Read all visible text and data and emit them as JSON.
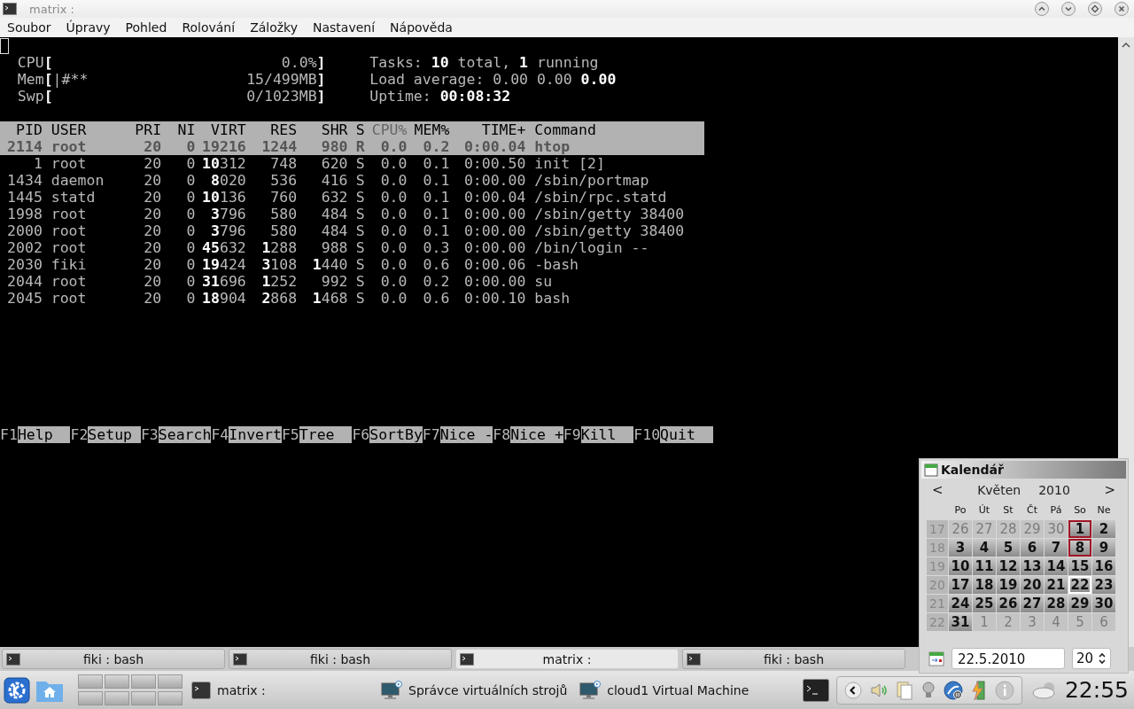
{
  "window": {
    "title": "matrix :"
  },
  "menu": [
    "Soubor",
    "Úpravy",
    "Pohled",
    "Rolování",
    "Záložky",
    "Nastavení",
    "Nápověda"
  ],
  "meters": [
    {
      "label": "CPU**[**",
      "value": "0.0%**]**"
    },
    {
      "label": "Mem**[**",
      "bar": "|#**",
      "value": "15/499MB**]**"
    },
    {
      "label": "Swp**[**",
      "value": "0/1023MB**]**"
    }
  ],
  "summary": [
    {
      "label": "Tasks:",
      "value": "**10** total, **1** running"
    },
    {
      "label": "Load average:",
      "value": "0.00 0.00 **0.00**"
    },
    {
      "label": "Uptime:",
      "value": "**00:08:32**"
    }
  ],
  "columns": [
    {
      "label": "PID",
      "sorted": false
    },
    {
      "label": "USER",
      "sorted": false
    },
    {
      "label": "PRI",
      "sorted": false
    },
    {
      "label": "NI",
      "sorted": false
    },
    {
      "label": "VIRT",
      "sorted": false
    },
    {
      "label": "RES",
      "sorted": false
    },
    {
      "label": "SHR",
      "sorted": false
    },
    {
      "label": "S",
      "sorted": false
    },
    {
      "label": "CPU%",
      "sorted": true
    },
    {
      "label": "MEM%",
      "sorted": false
    },
    {
      "label": "TIME+",
      "sorted": false
    },
    {
      "label": "Command",
      "sorted": false
    }
  ],
  "processes": [
    {
      "selected": true,
      "cells": [
        "2114",
        "root",
        "20",
        "0",
        "19216",
        "1244",
        "980",
        "R",
        "0.0",
        "0.2",
        "0:00.04",
        "htop"
      ]
    },
    {
      "selected": false,
      "cells": [
        "1",
        "root",
        "20",
        "0",
        "**10**312",
        "748",
        "620",
        "S",
        "0.0",
        "0.1",
        "0:00.50",
        "init [2]"
      ]
    },
    {
      "selected": false,
      "cells": [
        "1434",
        "daemon",
        "20",
        "0",
        "**8**020",
        "536",
        "416",
        "S",
        "0.0",
        "0.1",
        "0:00.00",
        "/sbin/portmap"
      ]
    },
    {
      "selected": false,
      "cells": [
        "1445",
        "statd",
        "20",
        "0",
        "**10**136",
        "760",
        "632",
        "S",
        "0.0",
        "0.1",
        "0:00.04",
        "/sbin/rpc.statd"
      ]
    },
    {
      "selected": false,
      "cells": [
        "1998",
        "root",
        "20",
        "0",
        "**3**796",
        "580",
        "484",
        "S",
        "0.0",
        "0.1",
        "0:00.00",
        "/sbin/getty 38400"
      ]
    },
    {
      "selected": false,
      "cells": [
        "2000",
        "root",
        "20",
        "0",
        "**3**796",
        "580",
        "484",
        "S",
        "0.0",
        "0.1",
        "0:00.00",
        "/sbin/getty 38400"
      ]
    },
    {
      "selected": false,
      "cells": [
        "2002",
        "root",
        "20",
        "0",
        "**45**632",
        "**1**288",
        "988",
        "S",
        "0.0",
        "0.3",
        "0:00.00",
        "/bin/login --"
      ]
    },
    {
      "selected": false,
      "cells": [
        "2030",
        "fiki",
        "20",
        "0",
        "**19**424",
        "**3**108",
        "**1**440",
        "S",
        "0.0",
        "0.6",
        "0:00.06",
        "-bash"
      ]
    },
    {
      "selected": false,
      "cells": [
        "2044",
        "root",
        "20",
        "0",
        "**31**696",
        "**1**252",
        "992",
        "S",
        "0.0",
        "0.2",
        "0:00.00",
        "su"
      ]
    },
    {
      "selected": false,
      "cells": [
        "2045",
        "root",
        "20",
        "0",
        "**18**904",
        "**2**868",
        "**1**468",
        "S",
        "0.0",
        "0.6",
        "0:00.10",
        "bash"
      ]
    }
  ],
  "function_keys": [
    {
      "key": "F1",
      "label": "Help"
    },
    {
      "key": "F2",
      "label": "Setup"
    },
    {
      "key": "F3",
      "label": "Search"
    },
    {
      "key": "F4",
      "label": "Invert"
    },
    {
      "key": "F5",
      "label": "Tree"
    },
    {
      "key": "F6",
      "label": "SortBy"
    },
    {
      "key": "F7",
      "label": "Nice -"
    },
    {
      "key": "F8",
      "label": "Nice +"
    },
    {
      "key": "F9",
      "label": "Kill"
    },
    {
      "key": "F10",
      "label": "Quit"
    }
  ],
  "tabs": [
    {
      "label": "fiki : bash",
      "selected": false
    },
    {
      "label": "fiki : bash",
      "selected": false
    },
    {
      "label": "matrix :",
      "selected": true
    },
    {
      "label": "fiki : bash",
      "selected": false
    }
  ],
  "tasks": [
    {
      "label": "matrix :",
      "kind": "terminal"
    },
    {
      "label": "Správce virtuálních strojů",
      "kind": "vm"
    },
    {
      "label": "cloud1 Virtual Machine",
      "kind": "vm"
    }
  ],
  "clock": "22:55",
  "calendar": {
    "title": "Kalendář",
    "prev": "<",
    "month": "Květen",
    "year": "2010",
    "next": ">",
    "weekdays": [
      "Po",
      "Út",
      "St",
      "Čt",
      "Pá",
      "So",
      "Ne"
    ],
    "weeks": [
      {
        "number": "17",
        "days": [
          {
            "label": "26",
            "in_month": false,
            "holiday": false,
            "selected": false
          },
          {
            "label": "27",
            "in_month": false,
            "holiday": false,
            "selected": false
          },
          {
            "label": "28",
            "in_month": false,
            "holiday": false,
            "selected": false
          },
          {
            "label": "29",
            "in_month": false,
            "holiday": false,
            "selected": false
          },
          {
            "label": "30",
            "in_month": false,
            "holiday": false,
            "selected": false
          },
          {
            "label": "1",
            "in_month": true,
            "holiday": true,
            "selected": false
          },
          {
            "label": "2",
            "in_month": true,
            "holiday": false,
            "selected": false
          }
        ]
      },
      {
        "number": "18",
        "days": [
          {
            "label": "3",
            "in_month": true,
            "holiday": false,
            "selected": false
          },
          {
            "label": "4",
            "in_month": true,
            "holiday": false,
            "selected": false
          },
          {
            "label": "5",
            "in_month": true,
            "holiday": false,
            "selected": false
          },
          {
            "label": "6",
            "in_month": true,
            "holiday": false,
            "selected": false
          },
          {
            "label": "7",
            "in_month": true,
            "holiday": false,
            "selected": false
          },
          {
            "label": "8",
            "in_month": true,
            "holiday": true,
            "selected": false
          },
          {
            "label": "9",
            "in_month": true,
            "holiday": false,
            "selected": false
          }
        ]
      },
      {
        "number": "19",
        "days": [
          {
            "label": "10",
            "in_month": true,
            "holiday": false,
            "selected": false
          },
          {
            "label": "11",
            "in_month": true,
            "holiday": false,
            "selected": false
          },
          {
            "label": "12",
            "in_month": true,
            "holiday": false,
            "selected": false
          },
          {
            "label": "13",
            "in_month": true,
            "holiday": false,
            "selected": false
          },
          {
            "label": "14",
            "in_month": true,
            "holiday": false,
            "selected": false
          },
          {
            "label": "15",
            "in_month": true,
            "holiday": false,
            "selected": false
          },
          {
            "label": "16",
            "in_month": true,
            "holiday": false,
            "selected": false
          }
        ]
      },
      {
        "number": "20",
        "days": [
          {
            "label": "17",
            "in_month": true,
            "holiday": false,
            "selected": false
          },
          {
            "label": "18",
            "in_month": true,
            "holiday": false,
            "selected": false
          },
          {
            "label": "19",
            "in_month": true,
            "holiday": false,
            "selected": false
          },
          {
            "label": "20",
            "in_month": true,
            "holiday": false,
            "selected": false
          },
          {
            "label": "21",
            "in_month": true,
            "holiday": false,
            "selected": false
          },
          {
            "label": "22",
            "in_month": true,
            "holiday": false,
            "selected": true
          },
          {
            "label": "23",
            "in_month": true,
            "holiday": false,
            "selected": false
          }
        ]
      },
      {
        "number": "21",
        "days": [
          {
            "label": "24",
            "in_month": true,
            "holiday": false,
            "selected": false
          },
          {
            "label": "25",
            "in_month": true,
            "holiday": false,
            "selected": false
          },
          {
            "label": "26",
            "in_month": true,
            "holiday": false,
            "selected": false
          },
          {
            "label": "27",
            "in_month": true,
            "holiday": false,
            "selected": false
          },
          {
            "label": "28",
            "in_month": true,
            "holiday": false,
            "selected": false
          },
          {
            "label": "29",
            "in_month": true,
            "holiday": false,
            "selected": false
          },
          {
            "label": "30",
            "in_month": true,
            "holiday": false,
            "selected": false
          }
        ]
      },
      {
        "number": "22",
        "days": [
          {
            "label": "31",
            "in_month": true,
            "holiday": false,
            "selected": false
          },
          {
            "label": "1",
            "in_month": false,
            "holiday": false,
            "selected": false
          },
          {
            "label": "2",
            "in_month": false,
            "holiday": false,
            "selected": false
          },
          {
            "label": "3",
            "in_month": false,
            "holiday": false,
            "selected": false
          },
          {
            "label": "4",
            "in_month": false,
            "holiday": false,
            "selected": false
          },
          {
            "label": "5",
            "in_month": false,
            "holiday": false,
            "selected": false
          },
          {
            "label": "6",
            "in_month": false,
            "holiday": false,
            "selected": false
          }
        ]
      }
    ],
    "date_field": "22.5.2010",
    "week_field": "20"
  }
}
